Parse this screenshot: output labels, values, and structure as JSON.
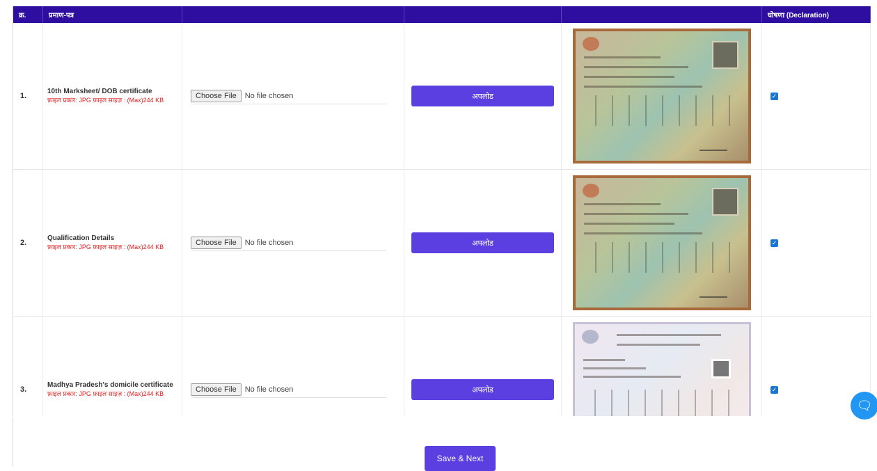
{
  "header": {
    "sn": "क्र.",
    "document": "प्रमाण-पत्र",
    "col3": "",
    "col4": "",
    "col5": "",
    "declaration": "घोषणा (Declaration)"
  },
  "rows": [
    {
      "sn": "1.",
      "title": "10th Marksheet/ DOB certificate",
      "hint": "फ़ाइल प्रकार: JPG फ़ाइल साइज़ : (Max)244 KB",
      "choose_label": "Choose File",
      "file_status": "No file chosen",
      "upload_label": "अपलोड",
      "declaration_checked": true
    },
    {
      "sn": "2.",
      "title": "Qualification Details",
      "hint": "फ़ाइल प्रकार: JPG फ़ाइल साइज़ : (Max)244 KB",
      "choose_label": "Choose File",
      "file_status": "No file chosen",
      "upload_label": "अपलोड",
      "declaration_checked": true
    },
    {
      "sn": "3.",
      "title": "Madhya Pradesh's domicile certificate",
      "hint": "फ़ाइल प्रकार: JPG फ़ाइल साइज़ : (Max)244 KB",
      "choose_label": "Choose File",
      "file_status": "No file chosen",
      "upload_label": "अपलोड",
      "declaration_checked": true
    }
  ],
  "actions": {
    "save_next": "Save & Next"
  },
  "colors": {
    "header_bg": "#2e0ea0",
    "button_bg": "#5b3fe0",
    "hint_text": "#e02020",
    "checkbox": "#1976d2",
    "chat_fab": "#2196f3"
  },
  "icons": {
    "chat": "chat-icon",
    "checkbox": "check-icon"
  }
}
